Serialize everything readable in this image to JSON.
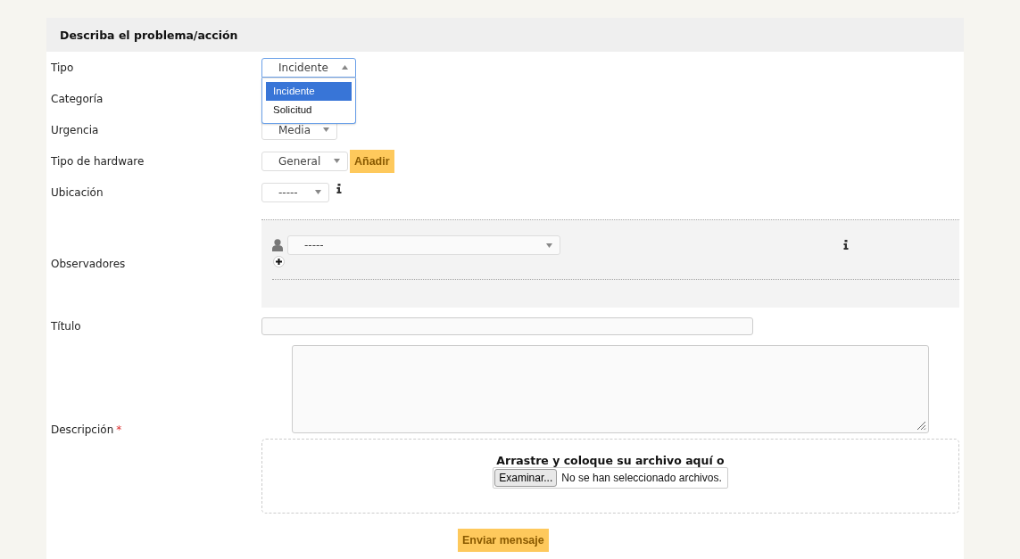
{
  "header": {
    "title": "Describa el problema/acción"
  },
  "fields": [
    {
      "kind": "select",
      "label": "Tipo",
      "value": "Incidente",
      "open": true,
      "options": [
        {
          "label": "Incidente",
          "selected": true
        },
        {
          "label": "Solicitud",
          "selected": false
        }
      ]
    },
    {
      "kind": "blank",
      "label": "Categoría"
    },
    {
      "kind": "select",
      "label": "Urgencia",
      "value": "Media",
      "open": false
    },
    {
      "kind": "select",
      "label": "Tipo de hardware",
      "value": "General",
      "open": false,
      "button": "Añadir"
    },
    {
      "kind": "select",
      "label": "Ubicación",
      "value": "-----",
      "open": false,
      "info": true
    },
    {
      "kind": "observers",
      "label": "Observadores",
      "value": "-----"
    },
    {
      "kind": "text",
      "label": "Título"
    },
    {
      "kind": "textarea",
      "label": "Descripción",
      "required_mark": "*",
      "dropzone": {
        "text": "Arrastre y coloque su archivo aquí o",
        "browse_button": "Examinar...",
        "status": "No se han seleccionado archivos."
      }
    }
  ],
  "submit": "Enviar mensaje"
}
